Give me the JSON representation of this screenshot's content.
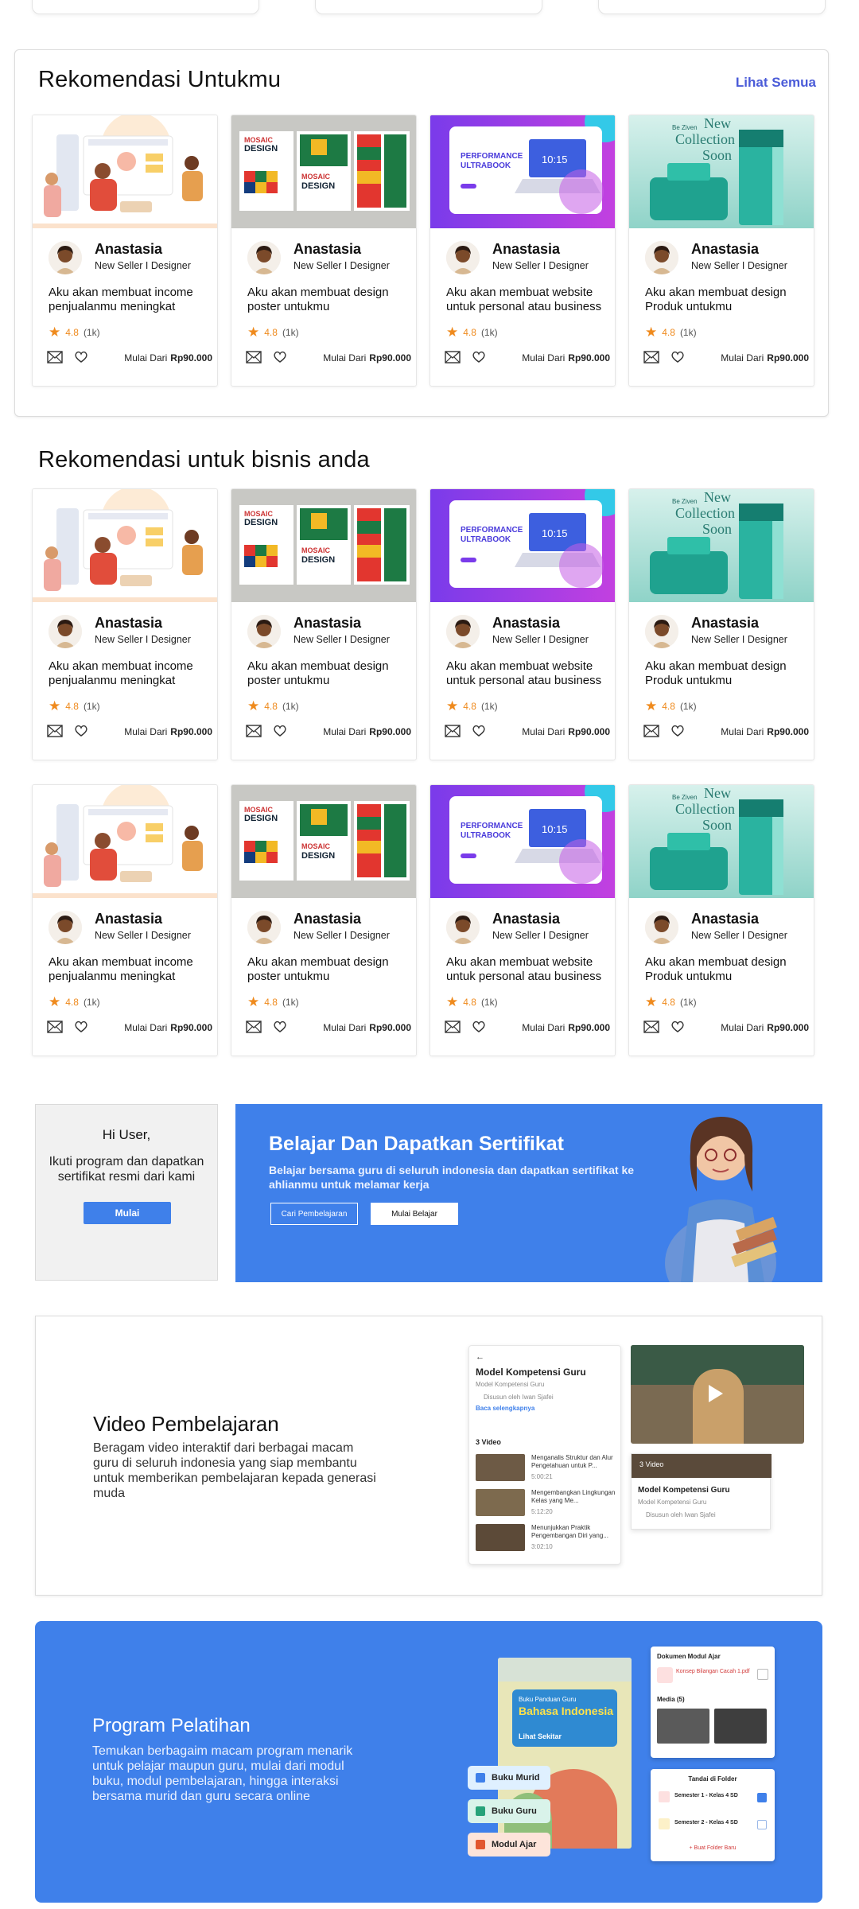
{
  "section1": {
    "title": "Rekomendasi Untukmu",
    "see_all": "Lihat Semua"
  },
  "section2": {
    "title": "Rekomendasi untuk bisnis anda"
  },
  "gigs": [
    {
      "seller": "Anastasia",
      "role": "New Seller I Designer",
      "title": "Aku akan membuat income penjualanmu meningkat",
      "rating": "4.8",
      "count": "(1k)",
      "price_prefix": "Mulai Dari",
      "price": "Rp90.000",
      "thumb_text": ""
    },
    {
      "seller": "Anastasia",
      "role": "New Seller I Designer",
      "title": "Aku akan membuat design poster untukmu",
      "rating": "4.8",
      "count": "(1k)",
      "price_prefix": "Mulai Dari",
      "price": "Rp90.000",
      "thumb_text": "MOSAIC DESIGN"
    },
    {
      "seller": "Anastasia",
      "role": "New Seller I Designer",
      "title": "Aku akan membuat website untuk personal atau business",
      "rating": "4.8",
      "count": "(1k)",
      "price_prefix": "Mulai Dari",
      "price": "Rp90.000",
      "thumb_text": "PERFORMANCE ULTRABOOK"
    },
    {
      "seller": "Anastasia",
      "role": "New Seller I Designer",
      "title": "Aku akan membuat design Produk untukmu",
      "rating": "4.8",
      "count": "(1k)",
      "price_prefix": "Mulai Dari",
      "price": "Rp90.000",
      "thumb_text": "New Collection Soon"
    }
  ],
  "hi_card": {
    "title": "Hi User,",
    "text": "Ikuti program dan dapatkan sertifikat resmi dari kami",
    "button": "Mulai"
  },
  "cert_banner": {
    "title": "Belajar Dan Dapatkan Sertifikat",
    "subtitle": "Belajar bersama guru di seluruh indonesia dan dapatkan sertifikat ke ahlianmu untuk melamar kerja",
    "btn_primary": "Cari Pembelajaran",
    "btn_secondary": "Mulai Belajar"
  },
  "video_section": {
    "title": "Video Pembelajaran",
    "text": "Beragam video interaktif dari berbagai macam guru di seluruh indonesia yang siap membantu untuk memberikan pembelajaran kepada generasi muda",
    "mock": {
      "panel_title": "Model Kompetensi Guru",
      "panel_sub": "Model Kompetensi Guru",
      "author": "Disusun oleh Iwan Sjafei",
      "read_more": "Baca selengkapnya",
      "video_count": "3 Video",
      "items": [
        {
          "title": "Menganalis Struktur dan Alur Pengetahuan untuk P...",
          "time": "5:00:21"
        },
        {
          "title": "Mengembangkan Lingkungan Kelas yang Me...",
          "time": "5:12:20"
        },
        {
          "title": "Menunjukkan Praktik Pengembangan Diri yang...",
          "time": "3:02:10"
        }
      ],
      "card_badge": "3 Video",
      "card_title": "Model Kompetensi Guru",
      "card_sub": "Model Kompetensi Guru",
      "card_author": "Disusun oleh Iwan Sjafei"
    }
  },
  "training_section": {
    "title": "Program Pelatihan",
    "text": "Temukan berbagaim macam program menarik untuk pelajar maupun guru, mulai dari modul buku, modul pembelajaran, hingga interaksi bersama murid dan guru secara online",
    "chips": [
      "Buku Murid",
      "Buku Guru",
      "Modul Ajar"
    ],
    "book": {
      "line1": "Buku Panduan Guru",
      "line2": "Bahasa Indonesia",
      "line3": "Lihat Sekitar"
    },
    "doc_panel": {
      "title": "Dokumen Modul Ajar",
      "file": "Konsep Bilangan Cacah 1.pdf",
      "media": "Media (5)"
    },
    "folder_panel": {
      "title": "Tandai di Folder",
      "items": [
        {
          "name": "Semester 1 - Kelas 4 SD",
          "checked": true
        },
        {
          "name": "Semester 2 - Kelas 4 SD",
          "checked": false
        }
      ],
      "new_folder": "+ Buat Folder Baru"
    }
  },
  "colors": {
    "accent_blue": "#3f80ea",
    "link_blue": "#4a5bd8",
    "star_orange": "#ef8a1d"
  }
}
